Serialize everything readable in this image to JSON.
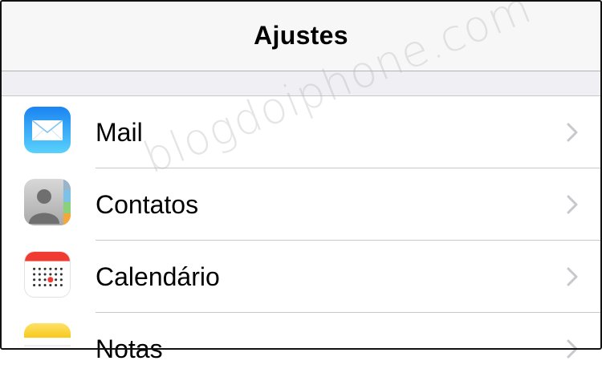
{
  "navbar": {
    "title": "Ajustes"
  },
  "rows": [
    {
      "label": "Mail",
      "icon": "mail-icon"
    },
    {
      "label": "Contatos",
      "icon": "contacts-icon"
    },
    {
      "label": "Calendário",
      "icon": "calendar-icon"
    },
    {
      "label": "Notas",
      "icon": "notes-icon"
    }
  ],
  "watermark": "blogdoiphone.com",
  "colors": {
    "mail_top": "#1e9bf5",
    "mail_bottom": "#5ad1fb",
    "calendar_red": "#f03b32",
    "notes_yellow": "#fcd43a",
    "chevron": "#c7c7cc",
    "separator": "#c8c7cc"
  }
}
